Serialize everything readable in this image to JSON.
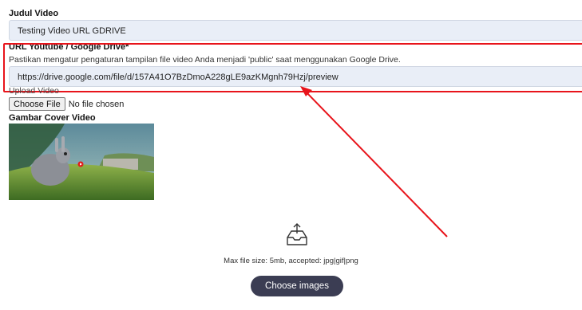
{
  "video_title": {
    "label": "Judul Video",
    "value": "Testing Video URL GDRIVE"
  },
  "url_field": {
    "label": "URL Youtube / Google Drive*",
    "help": "Pastikan mengatur pengaturan tampilan file video Anda menjadi 'public' saat menggunakan Google Drive.",
    "value": "https://drive.google.com/file/d/157A41O7BzDmoA228gLE9azKMgnh79Hzj/preview"
  },
  "upload_video": {
    "label": "Upload Video",
    "button_label": "Choose File",
    "status": "No file chosen"
  },
  "cover": {
    "label": "Gambar Cover Video"
  },
  "dropzone": {
    "icon": "upload-tray-icon",
    "max_size_text": "Max file size: 5mb, accepted: jpg|gif|png",
    "button_label": "Choose images"
  },
  "colors": {
    "highlight": "#e8141b",
    "field_bg": "#e9eef7",
    "primary_button": "#3b3d53"
  }
}
